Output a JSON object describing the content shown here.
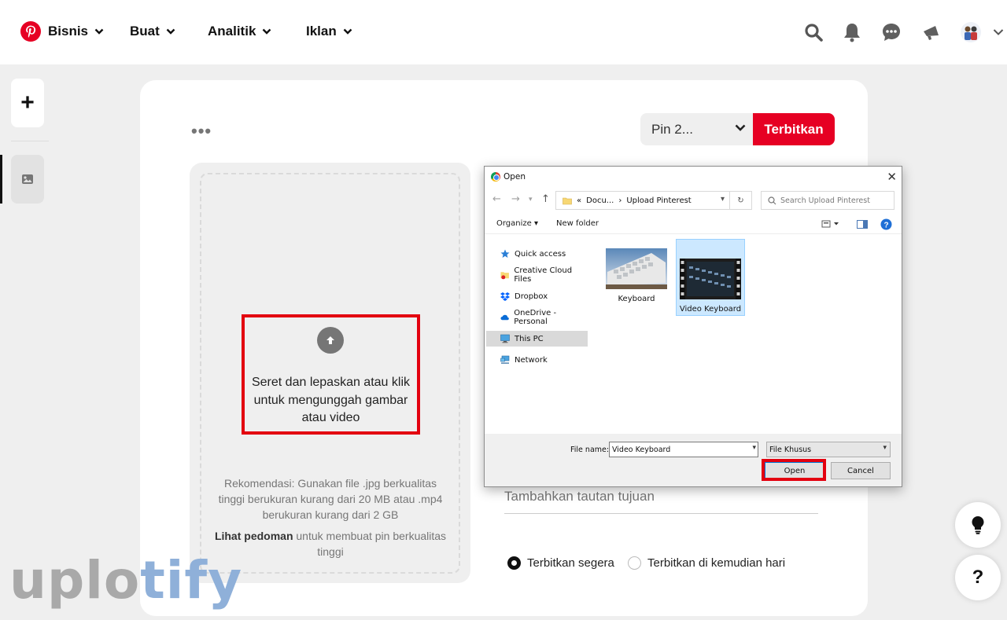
{
  "colors": {
    "brand": "#e60023",
    "highlight": "#e3000f",
    "watermark_gray": "#a9a9a9",
    "watermark_blue": "#8fb0d9"
  },
  "nav": {
    "logo_icon": "pinterest-logo",
    "items": [
      {
        "label": "Bisnis"
      },
      {
        "label": "Buat"
      },
      {
        "label": "Analitik"
      },
      {
        "label": "Iklan"
      }
    ],
    "icons": [
      "search-icon",
      "bell-icon",
      "chat-icon",
      "megaphone-icon",
      "avatar",
      "chevron-down-icon"
    ]
  },
  "rail": {
    "add_label": "+"
  },
  "card": {
    "more_label": "•••",
    "board_select": "Pin 2...",
    "publish_label": "Terbitkan"
  },
  "upload": {
    "main_text": "Seret dan lepaskan atau klik untuk mengunggah gambar atau video",
    "recommendation": "Rekomendasi: Gunakan file .jpg berkualitas tinggi berukuran kurang dari 20 MB atau .mp4 berukuran kurang dari 2 GB",
    "guide_bold": "Lihat pedoman",
    "guide_rest": " untuk membuat pin berkualitas tinggi"
  },
  "form": {
    "destination_placeholder": "Tambahkan tautan tujuan",
    "radio_now": "Terbitkan segera",
    "radio_later": "Terbitkan di kemudian hari"
  },
  "fabs": {
    "tips": "💡",
    "help": "?"
  },
  "watermark": {
    "part1": "uplo",
    "part2": "tify"
  },
  "dialog": {
    "title": "Open",
    "close": "✕",
    "address": {
      "prefix": "«",
      "crumb1": "Docu...",
      "sep": "›",
      "crumb2": "Upload Pinterest"
    },
    "search_placeholder": "Search Upload Pinterest",
    "toolbar": {
      "organize": "Organize ▾",
      "new_folder": "New folder"
    },
    "nav_items": [
      {
        "label": "Quick access"
      },
      {
        "label": "Creative Cloud Files"
      },
      {
        "label": "Dropbox"
      },
      {
        "label": "OneDrive - Personal"
      },
      {
        "label": "This PC"
      },
      {
        "label": "Network"
      }
    ],
    "files": [
      {
        "name": "Keyboard"
      },
      {
        "name": "Video Keyboard"
      }
    ],
    "file_name_label": "File name:",
    "file_name_value": "Video Keyboard",
    "file_type": "File Khusus",
    "open_label": "Open",
    "cancel_label": "Cancel"
  }
}
